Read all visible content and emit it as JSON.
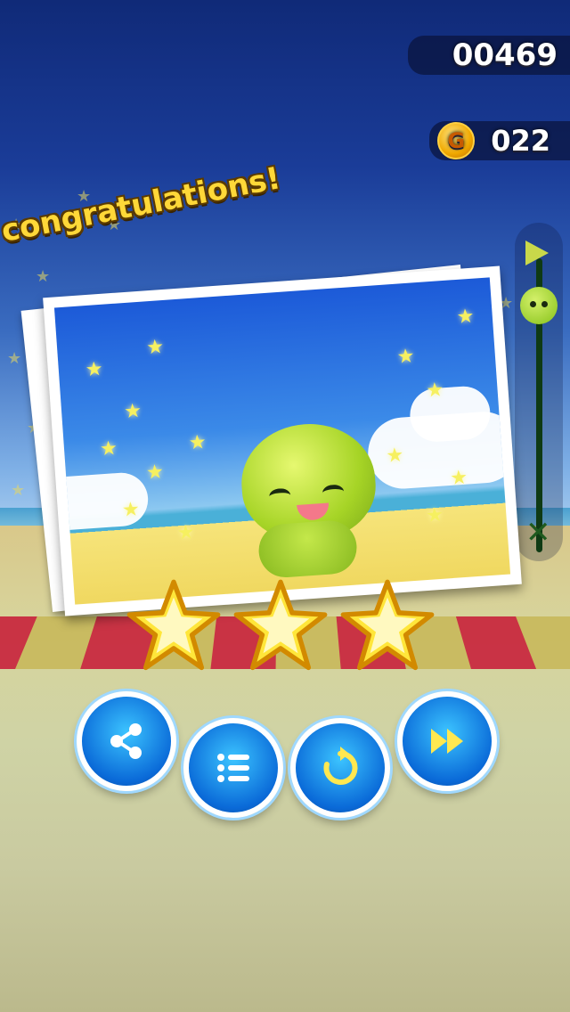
{
  "hud": {
    "score": "00469",
    "coins": "022",
    "coin_symbol": "G"
  },
  "banner": {
    "text": "congratulations!"
  },
  "result": {
    "stars_earned": 3,
    "stars_total": 3
  },
  "buttons": [
    {
      "name": "share-button",
      "icon": "share-icon"
    },
    {
      "name": "level-list-button",
      "icon": "list-icon"
    },
    {
      "name": "replay-button",
      "icon": "replay-icon"
    },
    {
      "name": "next-level-button",
      "icon": "fast-forward-icon"
    }
  ],
  "colors": {
    "star_gold": "#ffd800",
    "button_blue": "#0a6ad8",
    "banner_yellow": "#ffd838"
  }
}
